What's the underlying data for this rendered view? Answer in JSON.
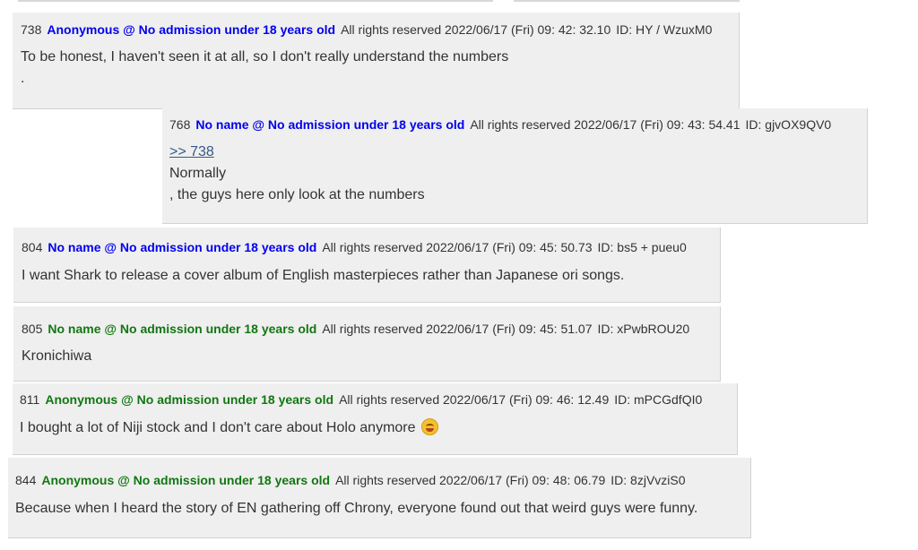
{
  "posts": [
    {
      "number": "738",
      "name": "Anonymous @ No admission under 18 years old",
      "date": "All rights reserved 2022/06/17 (Fri) 09: 42: 32.10",
      "id": "ID: HY / WzuxM0",
      "lines": [
        "To be honest, I haven't seen it at all, so I don't really understand the numbers",
        "."
      ]
    },
    {
      "number": "768",
      "name": "No name @ No admission under 18 years old",
      "date": "All rights reserved 2022/06/17 (Fri) 09: 43: 54.41",
      "id": "ID: gjvOX9QV0",
      "reply": ">> 738",
      "lines": [
        "Normally",
        ", the guys here only look at the numbers"
      ]
    },
    {
      "number": "804",
      "name": "No name @ No admission under 18 years old",
      "date": "All rights reserved 2022/06/17 (Fri) 09: 45: 50.73",
      "id": "ID: bs5 + pueu0",
      "lines": [
        "I want Shark to release a cover album of English masterpieces rather than Japanese ori songs."
      ]
    },
    {
      "number": "805",
      "name": "No name @ No admission under 18 years old",
      "date": "All rights reserved 2022/06/17 (Fri) 09: 45: 51.07",
      "id": "ID: xPwbROU20",
      "lines": [
        "Kronichiwa"
      ]
    },
    {
      "number": "811",
      "name": "Anonymous @ No admission under 18 years old",
      "date": "All rights reserved 2022/06/17 (Fri) 09: 46: 12.49",
      "id": "ID: mPCGdfQI0",
      "lines": [
        "I bought a lot of Niji stock and I don't care about Holo anymore"
      ],
      "emoji": "hugging-face-icon"
    },
    {
      "number": "844",
      "name": "Anonymous @ No admission under 18 years old",
      "date": "All rights reserved 2022/06/17 (Fri) 09: 48: 06.79",
      "id": "ID: 8zjVvziS0",
      "lines": [
        "Because when I heard the story of EN gathering off Chrony, everyone found out that weird guys were funny."
      ]
    }
  ],
  "colors": {
    "post_bg": "#efefef",
    "name_blue": "#0000ee",
    "name_green": "#117711",
    "link": "#34598a",
    "text": "#333333"
  }
}
